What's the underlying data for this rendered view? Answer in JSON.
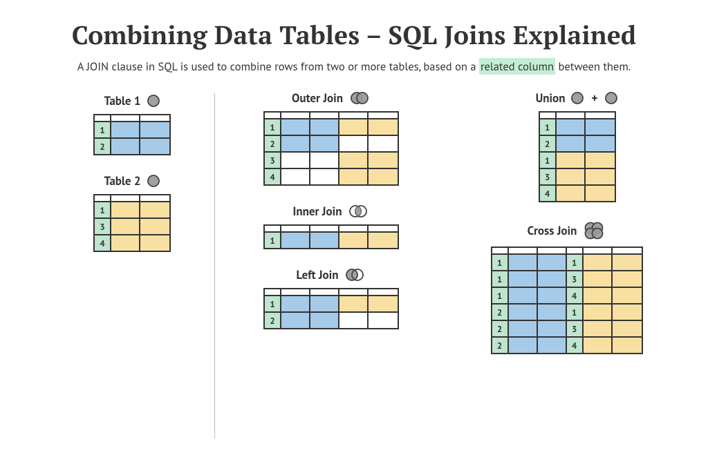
{
  "title": "Combining Data Tables – SQL Joins Explained",
  "subtitle_pre": "A JOIN clause in SQL is used to combine rows from two or more tables, based on a ",
  "subtitle_hl": "related column",
  "subtitle_post": " between them.",
  "colors": {
    "green": "#bfe5cf",
    "blue": "#a6cbe8",
    "yellow": "#f8e0a3"
  },
  "cell_widths": {
    "key": 24,
    "data": 42
  },
  "blocks": {
    "table1": {
      "label": "Table 1",
      "icon": "venn-single",
      "cols": [
        "key",
        "data",
        "data"
      ],
      "rows": [
        [
          {
            "t": "1",
            "c": "g"
          },
          {
            "c": "b"
          },
          {
            "c": "b"
          }
        ],
        [
          {
            "t": "2",
            "c": "g"
          },
          {
            "c": "b"
          },
          {
            "c": "b"
          }
        ]
      ]
    },
    "table2": {
      "label": "Table 2",
      "icon": "venn-single",
      "cols": [
        "key",
        "data",
        "data"
      ],
      "rows": [
        [
          {
            "t": "1",
            "c": "g"
          },
          {
            "c": "y"
          },
          {
            "c": "y"
          }
        ],
        [
          {
            "t": "3",
            "c": "g"
          },
          {
            "c": "y"
          },
          {
            "c": "y"
          }
        ],
        [
          {
            "t": "4",
            "c": "g"
          },
          {
            "c": "y"
          },
          {
            "c": "y"
          }
        ]
      ]
    },
    "outer": {
      "label": "Outer Join",
      "icon": "venn-outer",
      "cols": [
        "key",
        "data",
        "data",
        "data",
        "data"
      ],
      "rows": [
        [
          {
            "t": "1",
            "c": "g"
          },
          {
            "c": "b"
          },
          {
            "c": "b"
          },
          {
            "c": "y"
          },
          {
            "c": "y"
          }
        ],
        [
          {
            "t": "2",
            "c": "g"
          },
          {
            "c": "b"
          },
          {
            "c": "b"
          },
          {
            "c": "w"
          },
          {
            "c": "w"
          }
        ],
        [
          {
            "t": "3",
            "c": "g"
          },
          {
            "c": "w"
          },
          {
            "c": "w"
          },
          {
            "c": "y"
          },
          {
            "c": "y"
          }
        ],
        [
          {
            "t": "4",
            "c": "g"
          },
          {
            "c": "w"
          },
          {
            "c": "w"
          },
          {
            "c": "y"
          },
          {
            "c": "y"
          }
        ]
      ]
    },
    "inner": {
      "label": "Inner Join",
      "icon": "venn-inner",
      "cols": [
        "key",
        "data",
        "data",
        "data",
        "data"
      ],
      "rows": [
        [
          {
            "t": "1",
            "c": "g"
          },
          {
            "c": "b"
          },
          {
            "c": "b"
          },
          {
            "c": "y"
          },
          {
            "c": "y"
          }
        ]
      ]
    },
    "left": {
      "label": "Left Join",
      "icon": "venn-left",
      "cols": [
        "key",
        "data",
        "data",
        "data",
        "data"
      ],
      "rows": [
        [
          {
            "t": "1",
            "c": "g"
          },
          {
            "c": "b"
          },
          {
            "c": "b"
          },
          {
            "c": "y"
          },
          {
            "c": "y"
          }
        ],
        [
          {
            "t": "2",
            "c": "g"
          },
          {
            "c": "b"
          },
          {
            "c": "b"
          },
          {
            "c": "w"
          },
          {
            "c": "w"
          }
        ]
      ]
    },
    "union": {
      "label": "Union",
      "icon": "venn-union",
      "union_plus": "+",
      "cols": [
        "key",
        "data",
        "data"
      ],
      "rows": [
        [
          {
            "t": "1",
            "c": "g"
          },
          {
            "c": "b"
          },
          {
            "c": "b"
          }
        ],
        [
          {
            "t": "2",
            "c": "g"
          },
          {
            "c": "b"
          },
          {
            "c": "b"
          }
        ],
        [
          {
            "t": "1",
            "c": "g"
          },
          {
            "c": "y"
          },
          {
            "c": "y"
          }
        ],
        [
          {
            "t": "3",
            "c": "g"
          },
          {
            "c": "y"
          },
          {
            "c": "y"
          }
        ],
        [
          {
            "t": "4",
            "c": "g"
          },
          {
            "c": "y"
          },
          {
            "c": "y"
          }
        ]
      ]
    },
    "cross": {
      "label": "Cross Join",
      "icon": "venn-cross",
      "cols": [
        "key",
        "data",
        "data",
        "key",
        "data",
        "data"
      ],
      "rows": [
        [
          {
            "t": "1",
            "c": "g"
          },
          {
            "c": "b"
          },
          {
            "c": "b"
          },
          {
            "t": "1",
            "c": "g"
          },
          {
            "c": "y"
          },
          {
            "c": "y"
          }
        ],
        [
          {
            "t": "1",
            "c": "g"
          },
          {
            "c": "b"
          },
          {
            "c": "b"
          },
          {
            "t": "3",
            "c": "g"
          },
          {
            "c": "y"
          },
          {
            "c": "y"
          }
        ],
        [
          {
            "t": "1",
            "c": "g"
          },
          {
            "c": "b"
          },
          {
            "c": "b"
          },
          {
            "t": "4",
            "c": "g"
          },
          {
            "c": "y"
          },
          {
            "c": "y"
          }
        ],
        [
          {
            "t": "2",
            "c": "g"
          },
          {
            "c": "b"
          },
          {
            "c": "b"
          },
          {
            "t": "1",
            "c": "g"
          },
          {
            "c": "y"
          },
          {
            "c": "y"
          }
        ],
        [
          {
            "t": "2",
            "c": "g"
          },
          {
            "c": "b"
          },
          {
            "c": "b"
          },
          {
            "t": "3",
            "c": "g"
          },
          {
            "c": "y"
          },
          {
            "c": "y"
          }
        ],
        [
          {
            "t": "2",
            "c": "g"
          },
          {
            "c": "b"
          },
          {
            "c": "b"
          },
          {
            "t": "4",
            "c": "g"
          },
          {
            "c": "y"
          },
          {
            "c": "y"
          }
        ]
      ]
    }
  }
}
